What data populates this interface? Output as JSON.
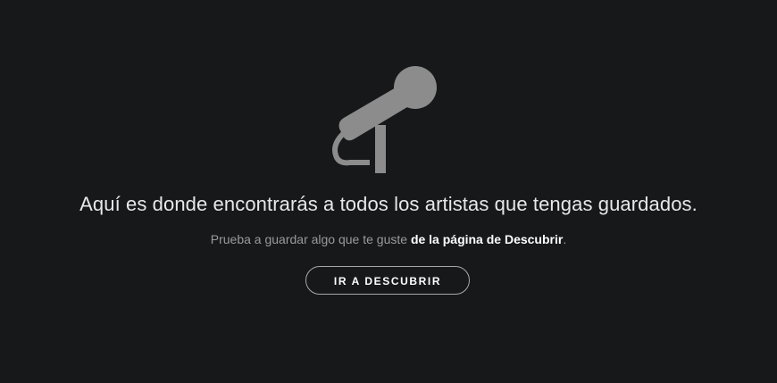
{
  "empty_state": {
    "icon": "microphone-icon",
    "headline": "Aquí es donde encontrarás a todos los artistas que tengas guardados.",
    "subline_prefix": "Prueba a guardar algo que te guste ",
    "subline_link": "de la página de Descubrir",
    "subline_suffix": ".",
    "button_label": "IR A DESCUBRIR"
  },
  "colors": {
    "background": "#17181a",
    "icon": "#8c8c8c",
    "headline": "#e8e8e8",
    "subline": "#9a9a9a",
    "link": "#ffffff",
    "button_border": "#a8a8a8"
  }
}
